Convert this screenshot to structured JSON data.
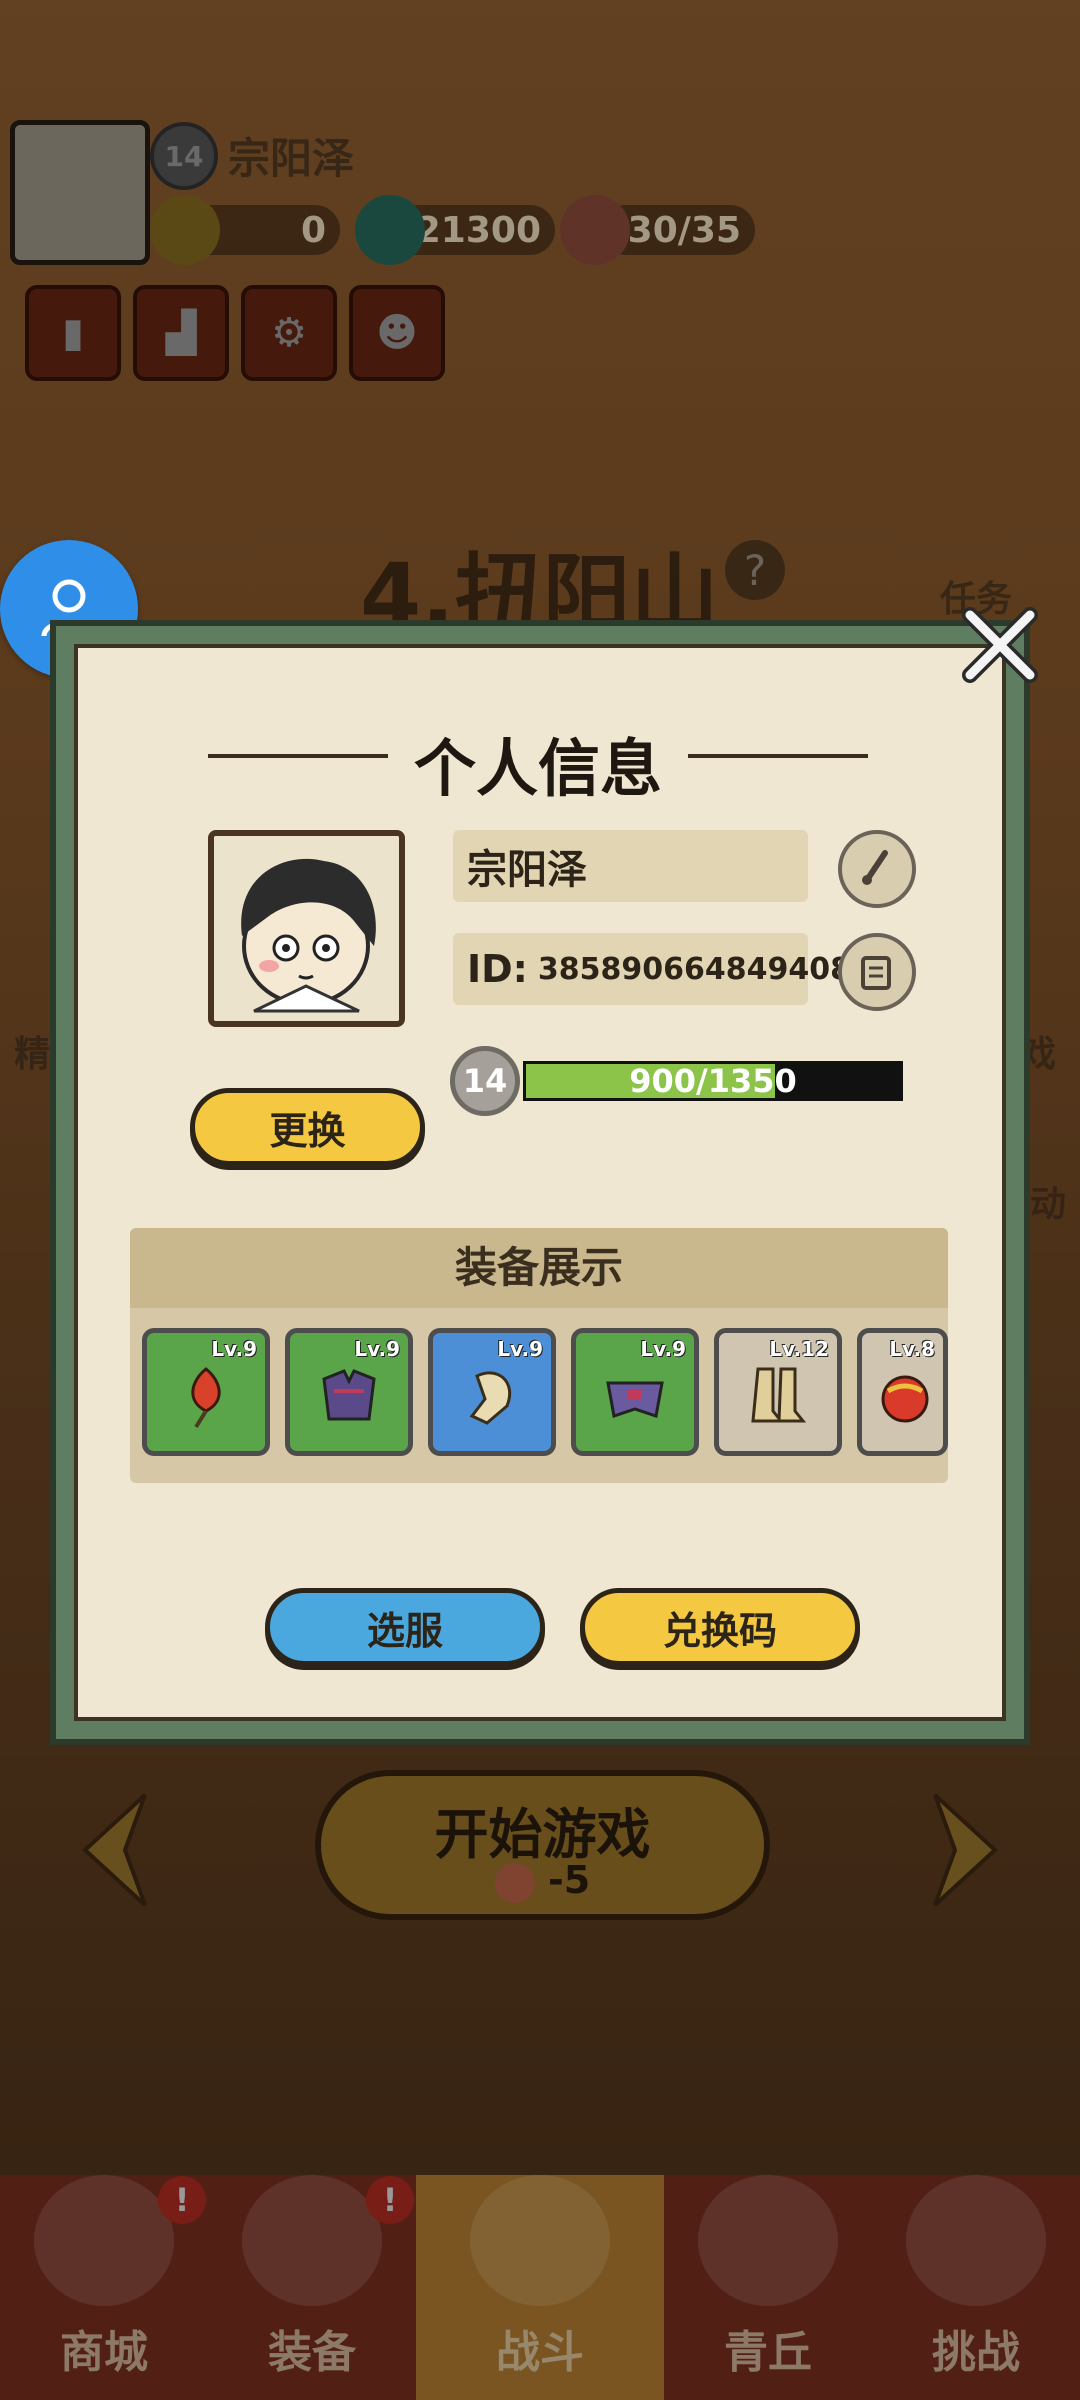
{
  "hud": {
    "level": "14",
    "name": "宗阳泽",
    "resources": [
      {
        "icon": "ticket-icon",
        "value": "0"
      },
      {
        "icon": "jade-coin-icon",
        "value": "21300"
      },
      {
        "icon": "peach-stamina-icon",
        "value": "130/35"
      }
    ],
    "buttons": [
      "card-icon",
      "ranking-icon",
      "settings-icon",
      "friends-icon"
    ]
  },
  "stage": {
    "title": "4.扭阳山",
    "help": "?"
  },
  "side": {
    "task": "任务",
    "left_partial": "精",
    "right_partial_1": "戏",
    "right_partial_2": "动"
  },
  "modal": {
    "title": "个人信息",
    "name": "宗阳泽",
    "id_label": "ID:",
    "id_value": "385890664849408",
    "level": "14",
    "xp_text": "900/1350",
    "xp_current": 900,
    "xp_max": 1350,
    "change_button": "更换",
    "equipment_title": "装备展示",
    "equipment": [
      {
        "level": "Lv.9",
        "rarity": "green",
        "item": "fire-charm-icon"
      },
      {
        "level": "Lv.9",
        "rarity": "green",
        "item": "armor-icon"
      },
      {
        "level": "Lv.9",
        "rarity": "blue",
        "item": "gauntlet-icon"
      },
      {
        "level": "Lv.9",
        "rarity": "green",
        "item": "belt-icon"
      },
      {
        "level": "Lv.12",
        "rarity": "gray",
        "item": "boots-icon"
      },
      {
        "level": "Lv.8",
        "rarity": "gray",
        "item": "orb-icon"
      }
    ],
    "server_button": "选服",
    "redeem_button": "兑换码"
  },
  "bottom": {
    "start_label": "开始游戏",
    "start_cost": "-5",
    "nav": [
      {
        "label": "商城",
        "badge": "!"
      },
      {
        "label": "装备",
        "badge": "!"
      },
      {
        "label": "战斗",
        "badge": ""
      },
      {
        "label": "青丘",
        "badge": ""
      },
      {
        "label": "挑战",
        "badge": ""
      }
    ]
  },
  "colors": {
    "green_slot": "#5aa54a",
    "blue_slot": "#4d8fd6",
    "gray_slot": "#cfc5b0",
    "accent_yellow": "#f5c842",
    "accent_blue": "#4ba8de"
  }
}
